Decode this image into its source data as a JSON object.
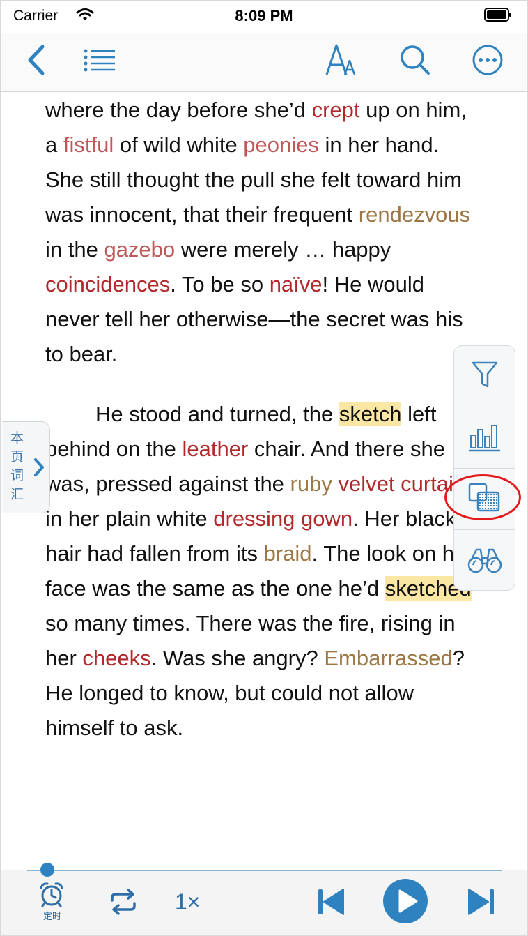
{
  "status_bar": {
    "carrier": "Carrier",
    "time": "8:09 PM"
  },
  "nav": {
    "back_icon": "chevron-left-icon",
    "toc_icon": "list-icon",
    "font_icon": "font-size-icon",
    "search_icon": "search-icon",
    "more_icon": "ellipsis-circle-icon"
  },
  "content": {
    "p1": [
      {
        "t": "where the day before she’d ",
        "c": ""
      },
      {
        "t": "crept",
        "c": "r"
      },
      {
        "t": " up on him, a ",
        "c": ""
      },
      {
        "t": "fistful",
        "c": "pk"
      },
      {
        "t": " of wild white ",
        "c": ""
      },
      {
        "t": "peonies",
        "c": "pk"
      },
      {
        "t": " in her hand. She still thought the pull she felt toward him was innocent, that their frequent ",
        "c": ""
      },
      {
        "t": "rendezvous",
        "c": "br"
      },
      {
        "t": " in the ",
        "c": ""
      },
      {
        "t": "gazebo",
        "c": "pk"
      },
      {
        "t": " were merely … happy ",
        "c": ""
      },
      {
        "t": "coincidences",
        "c": "r"
      },
      {
        "t": ". To be so ",
        "c": ""
      },
      {
        "t": "naïve",
        "c": "r"
      },
      {
        "t": "! He would never tell her otherwise—the secret was his to bear.",
        "c": ""
      }
    ],
    "p2": [
      {
        "t": "He stood and turned, the ",
        "c": ""
      },
      {
        "t": "sketch",
        "c": "hl"
      },
      {
        "t": " left behind on the ",
        "c": ""
      },
      {
        "t": "leather",
        "c": "r"
      },
      {
        "t": " chair. And there she was, pressed against the ",
        "c": ""
      },
      {
        "t": "ruby",
        "c": "br"
      },
      {
        "t": " ",
        "c": ""
      },
      {
        "t": "velvet curtain",
        "c": "r"
      },
      {
        "t": " in her plain white ",
        "c": ""
      },
      {
        "t": "dressing gown",
        "c": "r"
      },
      {
        "t": ". Her black hair had fallen from its ",
        "c": ""
      },
      {
        "t": "braid",
        "c": "br"
      },
      {
        "t": ". The look on her face was the same as the one he’d ",
        "c": ""
      },
      {
        "t": "sketched",
        "c": "hl"
      },
      {
        "t": " so many times. There was the fire, rising in her ",
        "c": ""
      },
      {
        "t": "cheeks",
        "c": "r"
      },
      {
        "t": ". Was she angry? ",
        "c": ""
      },
      {
        "t": "Embarrassed",
        "c": "br"
      },
      {
        "t": "? He longed to know, but could not allow himself to ask.",
        "c": ""
      }
    ]
  },
  "vocab_tab": {
    "chars": [
      "本",
      "页",
      "词",
      "汇"
    ]
  },
  "side_tools": [
    {
      "icon": "filter-icon"
    },
    {
      "icon": "bar-chart-icon"
    },
    {
      "icon": "overlay-squares-icon"
    },
    {
      "icon": "binoculars-icon"
    }
  ],
  "player": {
    "timer_label": "定时",
    "speed": "1×",
    "progress": 0.03,
    "icons": [
      "alarm-clock-icon",
      "repeat-icon",
      "skip-back-icon",
      "play-icon",
      "skip-forward-icon"
    ]
  },
  "colors": {
    "accent": "#2e82c0",
    "word_red": "#b3282a",
    "word_pink": "#c0585a",
    "word_brown": "#9d7846",
    "highlight": "#fbe7a4",
    "annotation": "#e3191c"
  }
}
